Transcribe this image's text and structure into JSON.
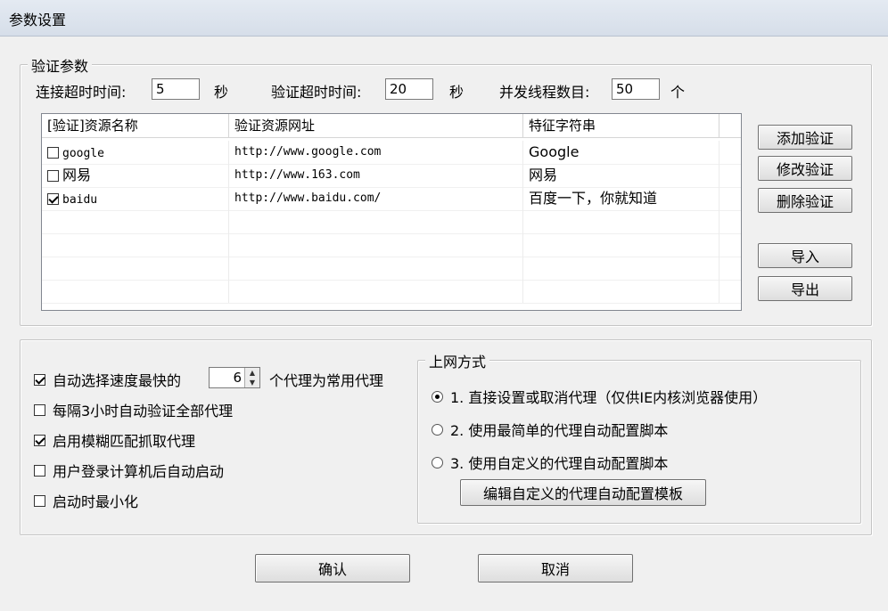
{
  "window": {
    "title": "参数设置"
  },
  "verify_group": {
    "legend": "验证参数",
    "conn_timeout_label": "连接超时时间:",
    "conn_timeout_value": "5",
    "conn_timeout_unit": "秒",
    "verify_timeout_label": "验证超时时间:",
    "verify_timeout_value": "20",
    "verify_timeout_unit": "秒",
    "threads_label": "并发线程数目:",
    "threads_value": "50",
    "threads_unit": "个"
  },
  "list": {
    "columns": [
      "[验证]资源名称",
      "验证资源网址",
      "特征字符串"
    ],
    "rows": [
      {
        "checked": false,
        "name": "google",
        "url": "http://www.google.com",
        "feature": "Google"
      },
      {
        "checked": false,
        "name": "网易",
        "url": "http://www.163.com",
        "feature": "网易"
      },
      {
        "checked": true,
        "name": "baidu",
        "url": "http://www.baidu.com/",
        "feature": "百度一下，你就知道"
      }
    ]
  },
  "side_buttons": {
    "add": "添加验证",
    "edit": "修改验证",
    "delete": "删除验证",
    "import": "导入",
    "export": "导出"
  },
  "options": {
    "auto_select_prefix": "自动选择速度最快的",
    "auto_select_count": "6",
    "auto_select_suffix": "个代理为常用代理",
    "every3h": "每隔3小时自动验证全部代理",
    "fuzzy": "启用模糊匹配抓取代理",
    "autostart": "用户登录计算机后自动启动",
    "minimize": "启动时最小化"
  },
  "net_group": {
    "legend": "上网方式",
    "opt1": "1. 直接设置或取消代理（仅供IE内核浏览器使用）",
    "opt2": "2. 使用最简单的代理自动配置脚本",
    "opt3": "3. 使用自定义的代理自动配置脚本",
    "edit_template": "编辑自定义的代理自动配置模板"
  },
  "footer": {
    "ok": "确认",
    "cancel": "取消"
  }
}
